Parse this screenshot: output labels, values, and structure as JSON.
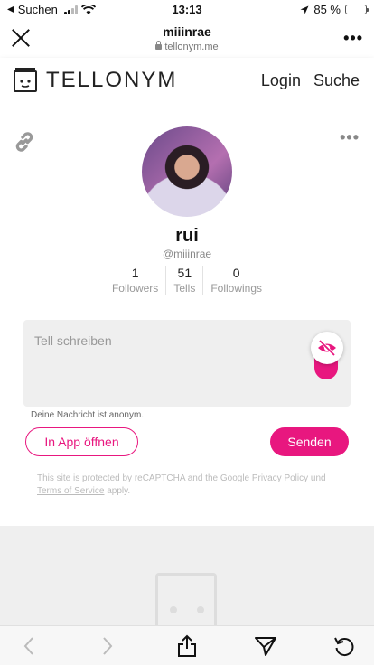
{
  "status_bar": {
    "back_app": "Suchen",
    "time": "13:13",
    "battery": "85 %",
    "battery_level": 0.85,
    "icons": [
      "signal-icon",
      "wifi-icon",
      "location-icon",
      "battery-icon"
    ]
  },
  "browser": {
    "title": "miiinrae",
    "url": "tellonym.me",
    "icons": [
      "close-icon",
      "lock-icon",
      "more-icon"
    ]
  },
  "site_header": {
    "logo_text": "TELLONYM",
    "nav": {
      "login": "Login",
      "search": "Suche"
    }
  },
  "profile": {
    "name": "rui",
    "handle": "@miiinrae",
    "stats": [
      {
        "value": "1",
        "label": "Followers"
      },
      {
        "value": "51",
        "label": "Tells"
      },
      {
        "value": "0",
        "label": "Followings"
      }
    ]
  },
  "tell_form": {
    "placeholder": "Tell schreiben",
    "anon_note": "Deine Nachricht ist anonym.",
    "open_app_label": "In App öffnen",
    "send_label": "Senden"
  },
  "recaptcha": {
    "prefix": "This site is protected by reCAPTCHA and the Google ",
    "privacy": "Privacy Policy",
    "and": " und ",
    "terms": "Terms of Service",
    "suffix": " apply."
  },
  "colors": {
    "accent": "#e8177f",
    "grey_bg": "#efefef"
  },
  "bottom_toolbar": [
    "back-icon",
    "forward-icon",
    "share-icon",
    "send-icon",
    "reload-icon"
  ]
}
